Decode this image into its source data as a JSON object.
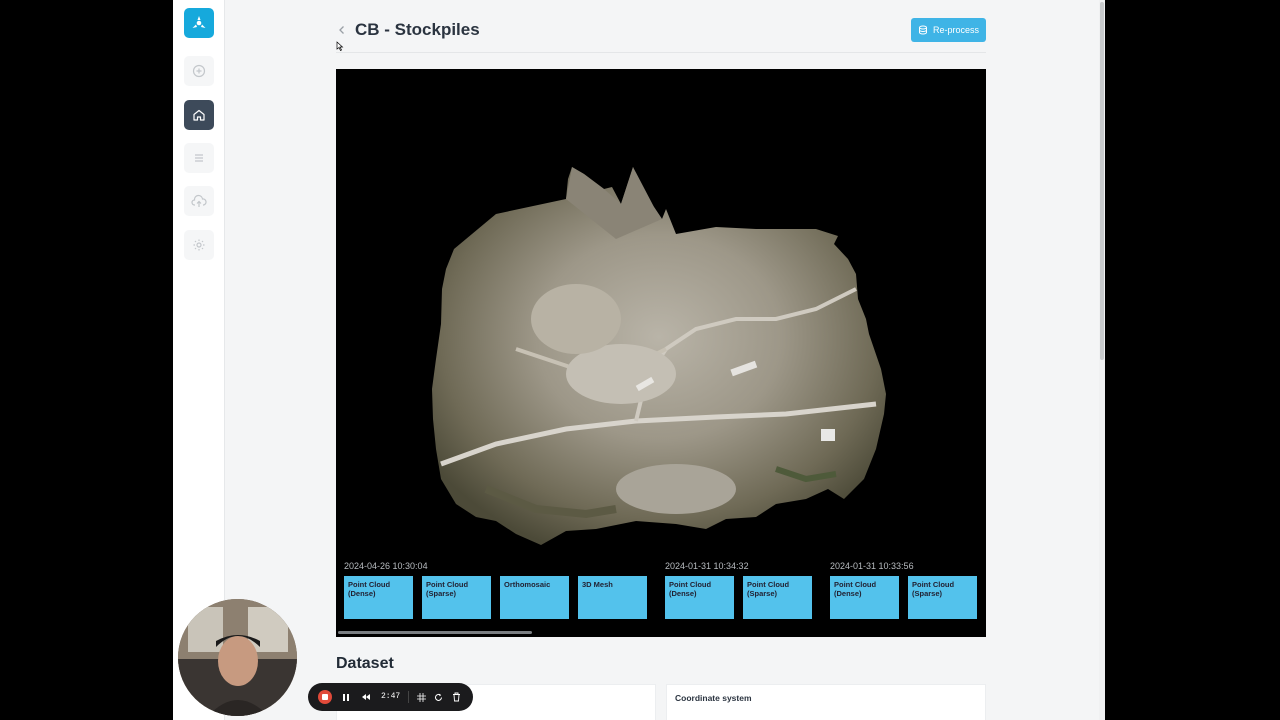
{
  "header": {
    "title": "CB - Stockpiles",
    "reprocess_label": "Re-process"
  },
  "sidebar": {
    "items": [
      {
        "name": "logo",
        "icon": "drone-logo-icon"
      },
      {
        "name": "add",
        "icon": "plus-circle-icon"
      },
      {
        "name": "home",
        "icon": "home-icon",
        "active": true
      },
      {
        "name": "list",
        "icon": "list-icon"
      },
      {
        "name": "upload",
        "icon": "cloud-upload-icon"
      },
      {
        "name": "settings",
        "icon": "gear-icon"
      }
    ]
  },
  "timeline": {
    "groups": [
      {
        "date": "2024-04-26 10:30:04",
        "tiles": [
          "Point Cloud (Dense)",
          "Point Cloud (Sparse)",
          "Orthomosaic",
          "3D Mesh"
        ]
      },
      {
        "date": "2024-01-31 10:34:32",
        "tiles": [
          "Point Cloud (Dense)",
          "Point Cloud (Sparse)"
        ]
      },
      {
        "date": "2024-01-31 10:33:56",
        "tiles": [
          "Point Cloud (Dense)",
          "Point Cloud (Sparse)"
        ]
      }
    ]
  },
  "dataset": {
    "title": "Dataset",
    "coordinate_label": "Coordinate system"
  },
  "recorder": {
    "time": "2:47"
  },
  "colors": {
    "accent": "#16a9dc",
    "tile": "#53c2ec",
    "sidebar_active": "#3d4a5a"
  }
}
